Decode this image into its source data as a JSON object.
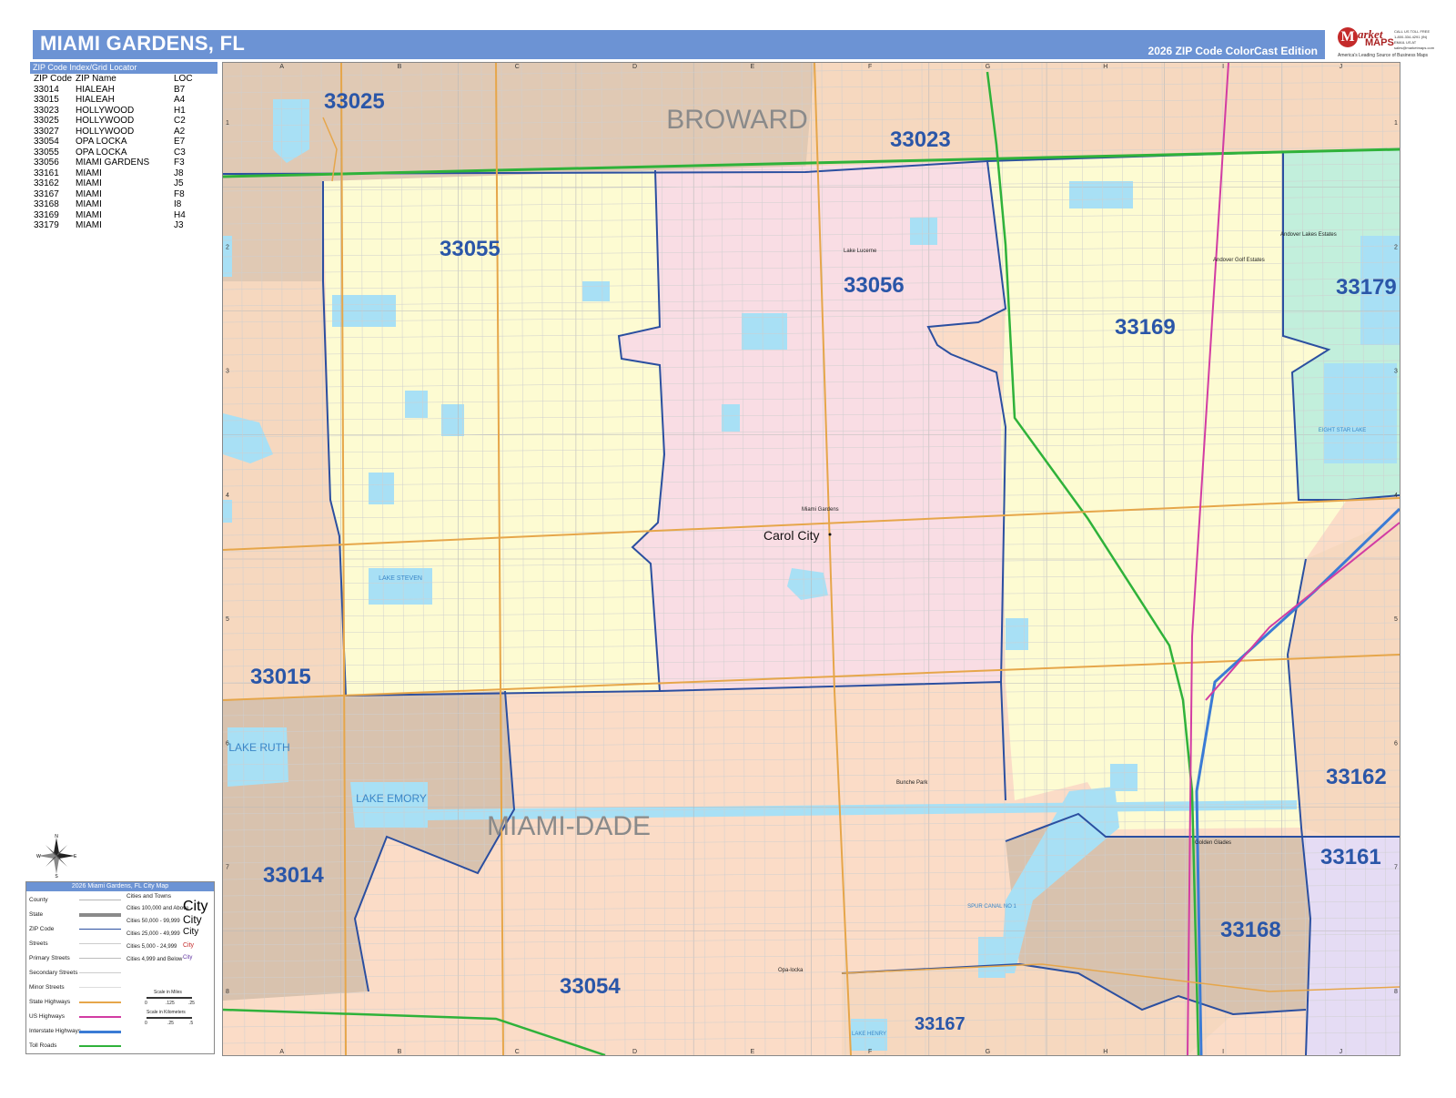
{
  "header": {
    "title": "MIAMI GARDENS, FL",
    "edition": "2026 ZIP Code ColorCast Edition"
  },
  "brand": {
    "logo_letter": "M",
    "name_top": "arket",
    "name_bottom": "MAPS",
    "tagline": "America's Leading Source of Business Maps",
    "contact": "CALL US TOLL FREE\n1-800-334-4291 (IN)\nEMAIL US AT\nsales@marketmaps.com"
  },
  "index": {
    "heading": "ZIP Code Index/Grid Locator",
    "columns": [
      "ZIP Code",
      "ZIP Name",
      "LOC"
    ],
    "rows": [
      [
        "33014",
        "HIALEAH",
        "B7"
      ],
      [
        "33015",
        "HIALEAH",
        "A4"
      ],
      [
        "33023",
        "HOLLYWOOD",
        "H1"
      ],
      [
        "33025",
        "HOLLYWOOD",
        "C2"
      ],
      [
        "33027",
        "HOLLYWOOD",
        "A2"
      ],
      [
        "33054",
        "OPA LOCKA",
        "E7"
      ],
      [
        "33055",
        "OPA LOCKA",
        "C3"
      ],
      [
        "33056",
        "MIAMI GARDENS",
        "F3"
      ],
      [
        "33161",
        "MIAMI",
        "J8"
      ],
      [
        "33162",
        "MIAMI",
        "J5"
      ],
      [
        "33167",
        "MIAMI",
        "F8"
      ],
      [
        "33168",
        "MIAMI",
        "I8"
      ],
      [
        "33169",
        "MIAMI",
        "H4"
      ],
      [
        "33179",
        "MIAMI",
        "J3"
      ]
    ]
  },
  "map": {
    "grid_columns": [
      "A",
      "B",
      "C",
      "D",
      "E",
      "F",
      "G",
      "H",
      "I",
      "J"
    ],
    "grid_rows": [
      "1",
      "2",
      "3",
      "4",
      "5",
      "6",
      "7",
      "8"
    ],
    "counties": [
      {
        "name": "BROWARD"
      },
      {
        "name": "MIAMI-DADE"
      }
    ],
    "zip_labels": [
      {
        "zip": "33025"
      },
      {
        "zip": "33023"
      },
      {
        "zip": "33055"
      },
      {
        "zip": "33056"
      },
      {
        "zip": "33179"
      },
      {
        "zip": "33169"
      },
      {
        "zip": "33015"
      },
      {
        "zip": "33162"
      },
      {
        "zip": "33014"
      },
      {
        "zip": "33161"
      },
      {
        "zip": "33168"
      },
      {
        "zip": "33054"
      },
      {
        "zip": "33167"
      }
    ],
    "city_labels": [
      {
        "name": "Carol City"
      }
    ],
    "small_places": [
      {
        "name": "Lake Lucerne"
      },
      {
        "name": "Andover Lakes Estates"
      },
      {
        "name": "Andover Golf Estates"
      },
      {
        "name": "Miami Gardens"
      },
      {
        "name": "Bunche Park"
      },
      {
        "name": "Golden Glades"
      },
      {
        "name": "Opa-locka"
      }
    ],
    "water_labels": [
      {
        "name": "LAKE STEVEN"
      },
      {
        "name": "LAKE RUTH"
      },
      {
        "name": "LAKE EMORY"
      },
      {
        "name": "EIGHT STAR LAKE"
      },
      {
        "name": "SPUR CANAL NO 1"
      },
      {
        "name": "LAKE HENRY"
      }
    ],
    "colors": {
      "zip_33025": "#e0c9b4",
      "zip_33023": "#f6d8bf",
      "zip_33055": "#fdfbd2",
      "zip_33056": "#f9dde4",
      "zip_33169": "#fdfbd2",
      "zip_33179": "#c2efdc",
      "zip_33015": "#f6d8bf",
      "zip_33014": "#d8c2ae",
      "zip_33054": "#fbdcc7",
      "zip_33168": "#d8c2ae",
      "zip_33162": "#f6d8bf",
      "zip_33161": "#e5dcf4",
      "zip_33167": "#f6d8bf",
      "water": "#a8e0f5",
      "zip_line": "#2b4fa0",
      "label": "#2a56a8",
      "highway_orange": "#e6a64a",
      "interstate": "#3a7bd5",
      "toll": "#2fb23a",
      "us_highway": "#d23ca3"
    }
  },
  "compass": {
    "north": "N",
    "south": "S",
    "east": "E",
    "west": "W"
  },
  "legend": {
    "heading": "2026 Miami Gardens, FL City Map",
    "left_items": [
      "County",
      "State",
      "ZIP Code",
      "Streets",
      "Primary Streets",
      "Secondary Streets",
      "Minor Streets",
      "State Highways",
      "US Highways",
      "Interstate Highways",
      "Toll Roads"
    ],
    "cities_heading": "Cities and Towns",
    "city_classes": [
      {
        "range": "Cities 100,000 and Above",
        "sample": "City"
      },
      {
        "range": "Cities 50,000 - 99,999",
        "sample": "City"
      },
      {
        "range": "Cities 25,000 - 49,999",
        "sample": "City"
      },
      {
        "range": "Cities 5,000 - 24,999",
        "sample": "City"
      },
      {
        "range": "Cities 4,999 and Below",
        "sample": "City"
      }
    ],
    "scale_miles_label": "Scale in Miles",
    "scale_miles_ticks": [
      "0",
      ".125",
      ".25"
    ],
    "scale_km_label": "Scale in Kilometers",
    "scale_km_ticks": [
      "0",
      ".25",
      ".5"
    ]
  }
}
